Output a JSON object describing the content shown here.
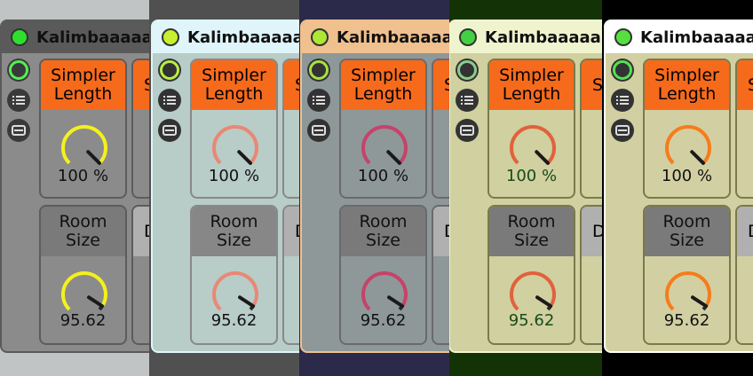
{
  "device": {
    "title": "Kalimbaaaaa",
    "sidebar_icons": [
      "power-ring-icon",
      "list-icon",
      "card-icon"
    ]
  },
  "macros": [
    {
      "label": "Simpler\nLength",
      "value": "100 %",
      "level": 1.0
    },
    {
      "label": "Room\nSize",
      "value": "95.62",
      "level": 0.9562
    },
    {
      "label": "S",
      "value": "",
      "level": 0
    },
    {
      "label": "D",
      "value": "",
      "level": 0
    }
  ],
  "themes": [
    {
      "name": "theme-dark-gray",
      "bg": "#c0c4c4",
      "frame": "#5a5a5a",
      "panel": "#8b8b8b",
      "border": "#5c5c5c",
      "power": "#2ee02e",
      "icon_bg": "#3a3a3a",
      "accent": "#f66a1c",
      "knob": "#f4f01f",
      "head2": "#7a7a7a",
      "value_color": "#111111",
      "ring_color": "#55ee55"
    },
    {
      "name": "theme-light-blue",
      "bg": "#505050",
      "frame": "#dff5fa",
      "panel": "#b8ccc8",
      "border": "#888888",
      "power": "#c6f030",
      "icon_bg": "#333333",
      "accent": "#f66a1c",
      "knob": "#e98874",
      "head2": "#878787",
      "value_color": "#111111",
      "ring_color": "#b8ee44"
    },
    {
      "name": "theme-peach",
      "bg": "#2b2a4a",
      "frame": "#f0c08e",
      "panel": "#8f9898",
      "border": "#6a6a6a",
      "power": "#aee634",
      "icon_bg": "#333333",
      "accent": "#f66a1c",
      "knob": "#c5436a",
      "head2": "#7a7a7a",
      "value_color": "#111111",
      "ring_color": "#a8e040"
    },
    {
      "name": "theme-olive",
      "bg": "#133307",
      "frame": "#f0f4ce",
      "panel": "#d0d0a0",
      "border": "#7a7a4a",
      "power": "#44d044",
      "icon_bg": "#333333",
      "accent": "#f66a1c",
      "knob": "#e0623c",
      "head2": "#7a7a7a",
      "value_color": "#1a4a1a",
      "ring_color": "#8ccc8c"
    },
    {
      "name": "theme-light",
      "bg": "#000000",
      "frame": "#ffffff",
      "panel": "#d2d0a2",
      "border": "#7a7a4a",
      "power": "#55e040",
      "icon_bg": "#333333",
      "accent": "#f66a1c",
      "knob": "#f67c1c",
      "head2": "#7a7a7a",
      "value_color": "#111111",
      "ring_color": "#55e055"
    }
  ]
}
